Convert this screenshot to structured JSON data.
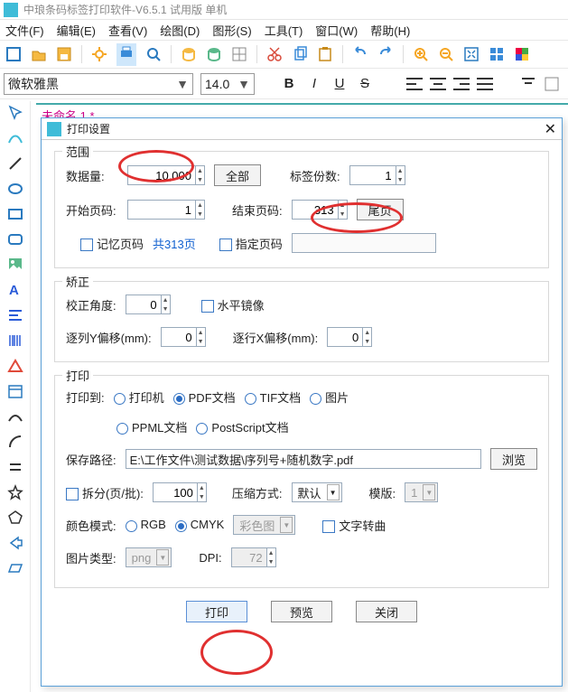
{
  "window": {
    "title": "中琅条码标签打印软件-V6.5.1 试用版 单机"
  },
  "menu": {
    "file": "文件(F)",
    "edit": "编辑(E)",
    "view": "查看(V)",
    "draw": "绘图(D)",
    "shape": "图形(S)",
    "tool": "工具(T)",
    "window": "窗口(W)",
    "help": "帮助(H)"
  },
  "fmt": {
    "font": "微软雅黑",
    "size": "14.0",
    "B": "B",
    "I": "I",
    "U": "U",
    "S": "S"
  },
  "canvas": {
    "tab": "未命名 1 *"
  },
  "dialog": {
    "title": "打印设置",
    "range": {
      "legend": "范围",
      "dataLabel": "数据量:",
      "dataValue": "10,000",
      "allBtn": "全部",
      "copiesLabel": "标签份数:",
      "copiesValue": "1",
      "startLabel": "开始页码:",
      "startValue": "1",
      "endLabel": "结束页码:",
      "endValue": "313",
      "tailBtn": "尾页",
      "remember": "记忆页码",
      "totalPages": "共313页",
      "specify": "指定页码"
    },
    "correct": {
      "legend": "矫正",
      "angleLabel": "校正角度:",
      "angleValue": "0",
      "mirror": "水平镜像",
      "colYLabel": "逐列Y偏移(mm):",
      "colYValue": "0",
      "rowXLabel": "逐行X偏移(mm):",
      "rowXValue": "0"
    },
    "print": {
      "legend": "打印",
      "toLabel": "打印到:",
      "opt_printer": "打印机",
      "opt_pdf": "PDF文档",
      "opt_tif": "TIF文档",
      "opt_img": "图片",
      "opt_ppml": "PPML文档",
      "opt_ps": "PostScript文档",
      "pathLabel": "保存路径:",
      "pathValue": "E:\\工作文件\\测试数据\\序列号+随机数字.pdf",
      "browse": "浏览",
      "split": "拆分(页/批):",
      "splitValue": "100",
      "compress": "压缩方式:",
      "compressValue": "默认",
      "template": "模版:",
      "templateValue": "1",
      "colorMode": "颜色模式:",
      "rgb": "RGB",
      "cmyk": "CMYK",
      "colorImg": "彩色图",
      "textCurve": "文字转曲",
      "imgType": "图片类型:",
      "imgTypeValue": "png",
      "dpi": "DPI:",
      "dpiValue": "72"
    },
    "buttons": {
      "print": "打印",
      "preview": "预览",
      "close": "关闭"
    }
  }
}
